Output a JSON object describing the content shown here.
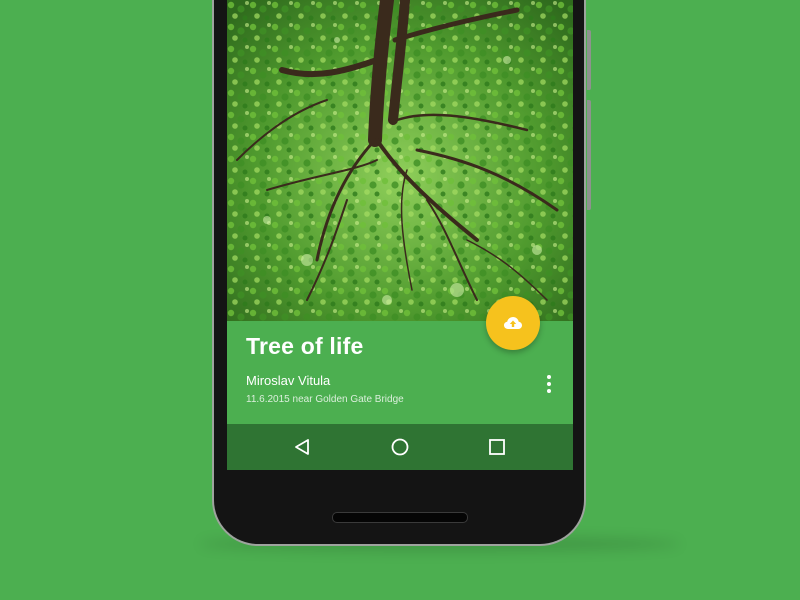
{
  "card": {
    "title": "Tree of life",
    "author": "Miroslav Vitula",
    "meta": "11.6.2015 near Golden Gate Bridge"
  },
  "icons": {
    "fab": "cloud-upload-icon",
    "more": "more-vert-icon",
    "nav_back": "back-triangle-icon",
    "nav_home": "home-circle-icon",
    "nav_recents": "recents-square-icon"
  },
  "colors": {
    "background": "#4caf50",
    "card": "#4caf50",
    "navbar": "#2f7433",
    "fab": "#f6c21d",
    "phone_body": "#141414"
  }
}
